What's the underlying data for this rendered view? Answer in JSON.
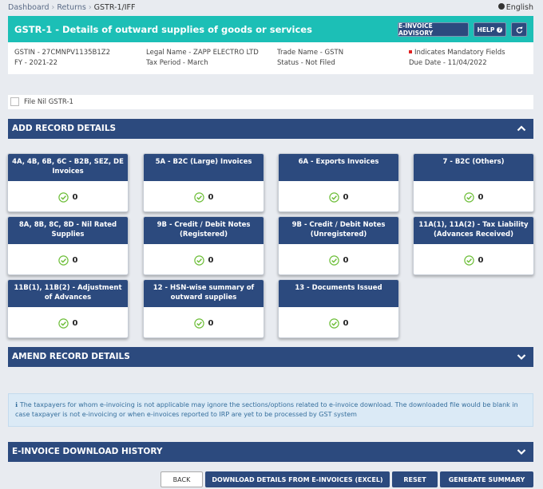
{
  "breadcrumb": {
    "items": [
      "Dashboard",
      "Returns"
    ],
    "current": "GSTR-1/IFF"
  },
  "language": "English",
  "header": {
    "title": "GSTR-1 - Details of outward supplies of goods or services",
    "einvoice_advisory": "E-INVOICE ADVISORY",
    "help": "HELP"
  },
  "info": {
    "gstin": "GSTIN - 27CMNPV1135B1Z2",
    "fy": "FY - 2021-22",
    "legal_name": "Legal Name - ZAPP ELECTRO LTD",
    "tax_period": "Tax Period - March",
    "trade_name": "Trade Name - GSTN",
    "status": "Status - Not Filed",
    "mandatory": "Indicates Mandatory Fields",
    "due_date": "Due Date - 11/04/2022"
  },
  "file_nil": "File Nil GSTR-1",
  "sections": {
    "add": "ADD RECORD DETAILS",
    "amend": "AMEND RECORD DETAILS",
    "history": "E-INVOICE DOWNLOAD HISTORY"
  },
  "tiles": [
    {
      "title": "4A, 4B, 6B, 6C - B2B, SEZ, DE Invoices",
      "count": "0"
    },
    {
      "title": "5A - B2C (Large) Invoices",
      "count": "0"
    },
    {
      "title": "6A - Exports Invoices",
      "count": "0"
    },
    {
      "title": "7 - B2C (Others)",
      "count": "0"
    },
    {
      "title": "8A, 8B, 8C, 8D - Nil Rated Supplies",
      "count": "0"
    },
    {
      "title": "9B - Credit / Debit Notes (Registered)",
      "count": "0"
    },
    {
      "title": "9B - Credit / Debit Notes (Unregistered)",
      "count": "0"
    },
    {
      "title": "11A(1), 11A(2) - Tax Liability (Advances Received)",
      "count": "0"
    },
    {
      "title": "11B(1), 11B(2) - Adjustment of Advances",
      "count": "0"
    },
    {
      "title": "12 - HSN-wise summary of outward supplies",
      "count": "0"
    },
    {
      "title": "13 - Documents Issued",
      "count": "0"
    }
  ],
  "note": "The taxpayers for whom e-invoicing is not applicable may ignore the sections/options related to e-invoice download. The downloaded file would be blank in case taxpayer is not e-invoicing or when e-invoices reported to IRP are yet to be processed by GST system",
  "footer": {
    "back": "BACK",
    "download": "DOWNLOAD DETAILS FROM E-INVOICES (EXCEL)",
    "reset": "RESET",
    "generate": "GENERATE SUMMARY"
  },
  "colors": {
    "teal": "#1cbfb6",
    "navy": "#2c4a7e",
    "check": "#6fbf3b",
    "mandatory": "#e02020"
  }
}
